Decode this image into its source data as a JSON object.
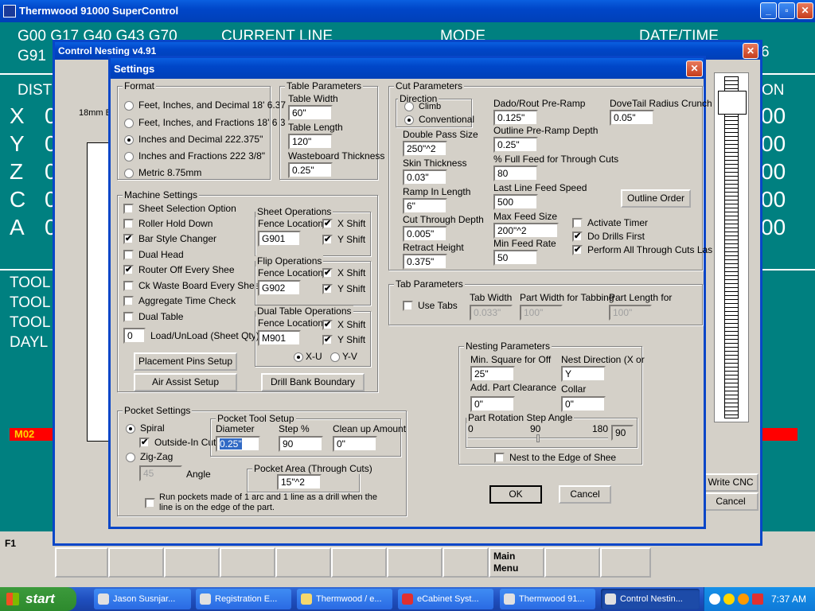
{
  "main": {
    "title": "Thermwood 91000 SuperControl",
    "gcode1": "G00 G17 G40 G43 G70",
    "gcode2": "G91",
    "current_line": "CURRENT LINE",
    "mode": "MODE",
    "datetime": "DATE/TIME",
    "dist": "DIST",
    "on": "ON",
    "axes": [
      "X",
      "Y",
      "Z",
      "C",
      "A"
    ],
    "axis_val": "0",
    "axis_right": "00",
    "m02": "M02",
    "tool": "TOOL",
    "dayl": "DAYL",
    "f1": "F1",
    "main_menu": "Main Menu",
    "write_cnc": "Write CNC",
    "cancel": "Cancel",
    "six": "6"
  },
  "nesting": {
    "title": "Control Nesting v4.91",
    "partial": "18mm B"
  },
  "dialog": {
    "title": "Settings",
    "format": {
      "legend": "Format",
      "options": [
        "Feet, Inches, and Decimal 18' 6.37",
        "Feet, Inches, and Fractions 18' 6 3",
        "Inches and Decimal 222.375\"",
        "Inches and Fractions 222 3/8\"",
        "Metric 8.75mm"
      ],
      "selected": 2
    },
    "table": {
      "legend": "Table Parameters",
      "width_label": "Table Width",
      "width": "60\"",
      "length_label": "Table Length",
      "length": "120\"",
      "waste_label": "Wasteboard Thickness",
      "waste": "0.25\""
    },
    "machine": {
      "legend": "Machine Settings",
      "checks": [
        {
          "label": "Sheet Selection Option",
          "checked": false
        },
        {
          "label": "Roller Hold Down",
          "checked": false
        },
        {
          "label": "Bar Style Changer",
          "checked": true
        },
        {
          "label": "Dual Head",
          "checked": false
        },
        {
          "label": "Router Off Every Shee",
          "checked": true
        },
        {
          "label": "Ck Waste Board Every Sheet",
          "checked": false
        },
        {
          "label": "Aggregate Time Check",
          "checked": false
        },
        {
          "label": "Dual Table",
          "checked": false
        }
      ],
      "load_val": "0",
      "load_label": "Load/UnLoad (Sheet Qty)",
      "placement_btn": "Placement Pins Setup",
      "air_btn": "Air Assist Setup",
      "drill_btn": "Drill Bank Boundary"
    },
    "sheet_ops": {
      "legend": "Sheet Operations",
      "fence_label": "Fence Location",
      "fence": "G901",
      "xshift": "X Shift",
      "yshift": "Y Shift"
    },
    "flip_ops": {
      "legend": "Flip Operations",
      "fence_label": "Fence Location",
      "fence": "G902",
      "xshift": "X Shift",
      "yshift": "Y Shift"
    },
    "dual_ops": {
      "legend": "Dual Table Operations",
      "fence_label": "Fence Location",
      "fence": "M901",
      "xshift": "X Shift",
      "yshift": "Y Shift",
      "xu": "X-U",
      "yv": "Y-V"
    },
    "cut": {
      "legend": "Cut Parameters",
      "direction": "Direction",
      "climb": "Climb",
      "conventional": "Conventional",
      "double_label": "Double Pass Size",
      "double": "250\"^2",
      "skin_label": "Skin Thickness",
      "skin": "0.03\"",
      "ramp_label": "Ramp In Length",
      "ramp": "6\"",
      "cut_depth_label": "Cut Through Depth",
      "cut_depth": "0.005\"",
      "retract_label": "Retract Height",
      "retract": "0.375\"",
      "dado_label": "Dado/Rout Pre-Ramp",
      "dado": "0.125\"",
      "outline_label": "Outline Pre-Ramp Depth",
      "outline": "0.25\"",
      "fullfeed_label": "% Full Feed for Through Cuts",
      "fullfeed": "80",
      "lastline_label": "Last Line Feed Speed",
      "lastline": "500",
      "maxfeed_label": "Max Feed Size",
      "maxfeed": "200\"^2",
      "minfeed_label": "Min Feed Rate",
      "minfeed": "50",
      "dovetail_label": "DoveTail Radius Crunch",
      "dovetail": "0.05\"",
      "outline_btn": "Outline Order",
      "activate_timer": "Activate Timer",
      "do_drills": "Do Drills First",
      "perform": "Perform All Through Cuts Las"
    },
    "tab": {
      "legend": "Tab Parameters",
      "use_tabs": "Use Tabs",
      "width_label": "Tab Width",
      "width": "0.033\"",
      "part_w_label": "Part Width for Tabbing",
      "part_w": "100\"",
      "part_l_label": "Part Length for",
      "part_l": "100\""
    },
    "nest": {
      "legend": "Nesting Parameters",
      "min_sq_label": "Min. Square for Off",
      "min_sq": "25\"",
      "dir_label": "Nest Direction (X or",
      "dir": "Y",
      "clear_label": "Add. Part Clearance",
      "clear": "0\"",
      "collar_label": "Collar",
      "collar": "0\"",
      "rot_legend": "Part Rotation Step Angle",
      "rot_0": "0",
      "rot_90": "90",
      "rot_180": "180",
      "rot_val": "90",
      "rot_level": 0.5,
      "edge": "Nest to the Edge of Shee"
    },
    "pocket": {
      "legend": "Pocket Settings",
      "spiral": "Spiral",
      "outside": "Outside-In Cut",
      "zigzag": "Zig-Zag",
      "angle_val": "45",
      "angle_label": "Angle",
      "tool_legend": "Pocket Tool Setup",
      "diam_label": "Diameter",
      "diam": "0.25\"",
      "step_label": "Step %",
      "step": "90",
      "clean_label": "Clean up Amount",
      "clean": "0\"",
      "area_legend": "Pocket Area (Through Cuts)",
      "area": "15\"^2",
      "run_line1": "Run pockets made of 1 arc and 1 line as a drill when the",
      "run_line2": "line is on the edge of the part."
    },
    "ok": "OK",
    "cancel": "Cancel"
  },
  "taskbar": {
    "start": "start",
    "items": [
      "Jason Susnjar...",
      "Registration E...",
      "Thermwood / e...",
      "eCabinet Syst...",
      "Thermwood 91...",
      "Control Nestin..."
    ],
    "clock": "7:37 AM"
  }
}
